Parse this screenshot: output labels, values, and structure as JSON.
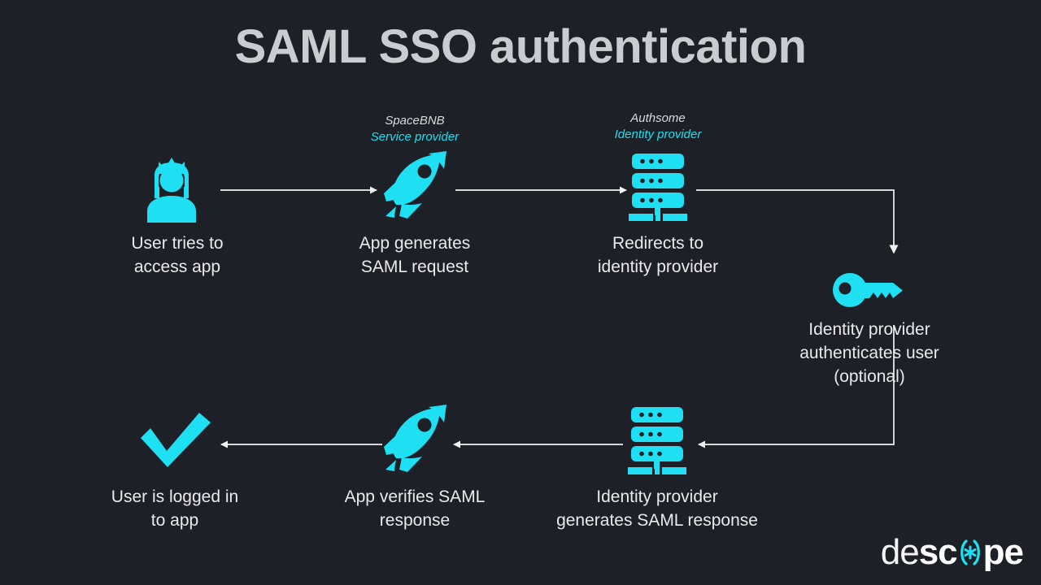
{
  "page": {
    "title": "SAML SSO authentication",
    "background_color": "#1d2026",
    "accent_color": "#1fdff2",
    "text_color": "#e8eaed",
    "arrow_color": "#f0f2f4"
  },
  "parties": [
    {
      "id": "service-provider",
      "name": "SpaceBNB",
      "role": "Service provider"
    },
    {
      "id": "identity-provider",
      "name": "Authsome",
      "role": "Identity provider"
    }
  ],
  "steps": [
    {
      "id": "user-access",
      "icon": "user-crown-icon",
      "caption_line1": "User tries to",
      "caption_line2": "access app",
      "caption": "User tries to\naccess app"
    },
    {
      "id": "app-generates-request",
      "icon": "rocket-icon",
      "caption_line1": "App generates",
      "caption_line2": "SAML request",
      "caption": "App generates\nSAML request"
    },
    {
      "id": "redirect-to-idp",
      "icon": "server-icon",
      "caption_line1": "Redirects to",
      "caption_line2": "identity provider",
      "caption": "Redirects to\nidentity provider"
    },
    {
      "id": "idp-authenticates",
      "icon": "key-icon",
      "caption_line1": "Identity provider",
      "caption_line2": "authenticates user",
      "caption_line3": "(optional)",
      "caption": "Identity provider\nauthenticates user\n(optional)"
    },
    {
      "id": "idp-generates-response",
      "icon": "server-icon",
      "caption_line1": "Identity provider",
      "caption_line2": "generates SAML response",
      "caption": "Identity provider\ngenerates SAML response"
    },
    {
      "id": "app-verifies-response",
      "icon": "rocket-icon",
      "caption_line1": "App verifies SAML",
      "caption_line2": "response",
      "caption": "App verifies SAML\nresponse"
    },
    {
      "id": "user-logged-in",
      "icon": "check-icon",
      "caption_line1": "User is logged in",
      "caption_line2": "to app",
      "caption": "User is logged in\nto app"
    }
  ],
  "logo": {
    "part1": "de",
    "part2": "sc",
    "mark": "(*)",
    "part3": "pe",
    "full": "descope"
  }
}
